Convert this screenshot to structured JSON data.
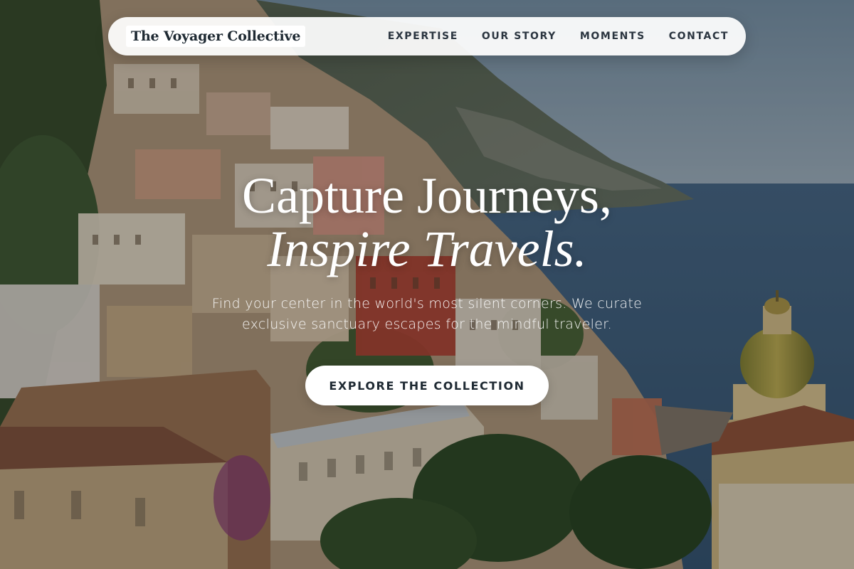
{
  "brand": {
    "name": "The Voyager Collective"
  },
  "nav": {
    "items": [
      {
        "label": "EXPERTISE"
      },
      {
        "label": "OUR STORY"
      },
      {
        "label": "MOMENTS"
      },
      {
        "label": "CONTACT"
      }
    ]
  },
  "hero": {
    "headline_line1": "Capture Journeys,",
    "headline_line2": "Inspire Travels.",
    "subtext": "Find your center in the world's most silent corners. We curate exclusive sanctuary escapes for the mindful traveler.",
    "cta_label": "EXPLORE THE COLLECTION"
  },
  "colors": {
    "nav_background": "#ffffff",
    "nav_text": "#2b3540",
    "hero_text": "#ffffff",
    "cta_background": "#ffffff",
    "cta_text": "#1f2a33"
  }
}
